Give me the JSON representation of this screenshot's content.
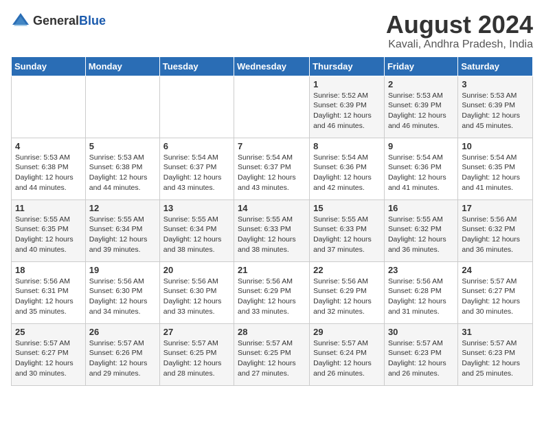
{
  "header": {
    "logo_general": "General",
    "logo_blue": "Blue",
    "title": "August 2024",
    "subtitle": "Kavali, Andhra Pradesh, India"
  },
  "days_of_week": [
    "Sunday",
    "Monday",
    "Tuesday",
    "Wednesday",
    "Thursday",
    "Friday",
    "Saturday"
  ],
  "weeks": [
    [
      {
        "day": "",
        "detail": ""
      },
      {
        "day": "",
        "detail": ""
      },
      {
        "day": "",
        "detail": ""
      },
      {
        "day": "",
        "detail": ""
      },
      {
        "day": "1",
        "detail": "Sunrise: 5:52 AM\nSunset: 6:39 PM\nDaylight: 12 hours\nand 46 minutes."
      },
      {
        "day": "2",
        "detail": "Sunrise: 5:53 AM\nSunset: 6:39 PM\nDaylight: 12 hours\nand 46 minutes."
      },
      {
        "day": "3",
        "detail": "Sunrise: 5:53 AM\nSunset: 6:39 PM\nDaylight: 12 hours\nand 45 minutes."
      }
    ],
    [
      {
        "day": "4",
        "detail": "Sunrise: 5:53 AM\nSunset: 6:38 PM\nDaylight: 12 hours\nand 44 minutes."
      },
      {
        "day": "5",
        "detail": "Sunrise: 5:53 AM\nSunset: 6:38 PM\nDaylight: 12 hours\nand 44 minutes."
      },
      {
        "day": "6",
        "detail": "Sunrise: 5:54 AM\nSunset: 6:37 PM\nDaylight: 12 hours\nand 43 minutes."
      },
      {
        "day": "7",
        "detail": "Sunrise: 5:54 AM\nSunset: 6:37 PM\nDaylight: 12 hours\nand 43 minutes."
      },
      {
        "day": "8",
        "detail": "Sunrise: 5:54 AM\nSunset: 6:36 PM\nDaylight: 12 hours\nand 42 minutes."
      },
      {
        "day": "9",
        "detail": "Sunrise: 5:54 AM\nSunset: 6:36 PM\nDaylight: 12 hours\nand 41 minutes."
      },
      {
        "day": "10",
        "detail": "Sunrise: 5:54 AM\nSunset: 6:35 PM\nDaylight: 12 hours\nand 41 minutes."
      }
    ],
    [
      {
        "day": "11",
        "detail": "Sunrise: 5:55 AM\nSunset: 6:35 PM\nDaylight: 12 hours\nand 40 minutes."
      },
      {
        "day": "12",
        "detail": "Sunrise: 5:55 AM\nSunset: 6:34 PM\nDaylight: 12 hours\nand 39 minutes."
      },
      {
        "day": "13",
        "detail": "Sunrise: 5:55 AM\nSunset: 6:34 PM\nDaylight: 12 hours\nand 38 minutes."
      },
      {
        "day": "14",
        "detail": "Sunrise: 5:55 AM\nSunset: 6:33 PM\nDaylight: 12 hours\nand 38 minutes."
      },
      {
        "day": "15",
        "detail": "Sunrise: 5:55 AM\nSunset: 6:33 PM\nDaylight: 12 hours\nand 37 minutes."
      },
      {
        "day": "16",
        "detail": "Sunrise: 5:55 AM\nSunset: 6:32 PM\nDaylight: 12 hours\nand 36 minutes."
      },
      {
        "day": "17",
        "detail": "Sunrise: 5:56 AM\nSunset: 6:32 PM\nDaylight: 12 hours\nand 36 minutes."
      }
    ],
    [
      {
        "day": "18",
        "detail": "Sunrise: 5:56 AM\nSunset: 6:31 PM\nDaylight: 12 hours\nand 35 minutes."
      },
      {
        "day": "19",
        "detail": "Sunrise: 5:56 AM\nSunset: 6:30 PM\nDaylight: 12 hours\nand 34 minutes."
      },
      {
        "day": "20",
        "detail": "Sunrise: 5:56 AM\nSunset: 6:30 PM\nDaylight: 12 hours\nand 33 minutes."
      },
      {
        "day": "21",
        "detail": "Sunrise: 5:56 AM\nSunset: 6:29 PM\nDaylight: 12 hours\nand 33 minutes."
      },
      {
        "day": "22",
        "detail": "Sunrise: 5:56 AM\nSunset: 6:29 PM\nDaylight: 12 hours\nand 32 minutes."
      },
      {
        "day": "23",
        "detail": "Sunrise: 5:56 AM\nSunset: 6:28 PM\nDaylight: 12 hours\nand 31 minutes."
      },
      {
        "day": "24",
        "detail": "Sunrise: 5:57 AM\nSunset: 6:27 PM\nDaylight: 12 hours\nand 30 minutes."
      }
    ],
    [
      {
        "day": "25",
        "detail": "Sunrise: 5:57 AM\nSunset: 6:27 PM\nDaylight: 12 hours\nand 30 minutes."
      },
      {
        "day": "26",
        "detail": "Sunrise: 5:57 AM\nSunset: 6:26 PM\nDaylight: 12 hours\nand 29 minutes."
      },
      {
        "day": "27",
        "detail": "Sunrise: 5:57 AM\nSunset: 6:25 PM\nDaylight: 12 hours\nand 28 minutes."
      },
      {
        "day": "28",
        "detail": "Sunrise: 5:57 AM\nSunset: 6:25 PM\nDaylight: 12 hours\nand 27 minutes."
      },
      {
        "day": "29",
        "detail": "Sunrise: 5:57 AM\nSunset: 6:24 PM\nDaylight: 12 hours\nand 26 minutes."
      },
      {
        "day": "30",
        "detail": "Sunrise: 5:57 AM\nSunset: 6:23 PM\nDaylight: 12 hours\nand 26 minutes."
      },
      {
        "day": "31",
        "detail": "Sunrise: 5:57 AM\nSunset: 6:23 PM\nDaylight: 12 hours\nand 25 minutes."
      }
    ]
  ]
}
